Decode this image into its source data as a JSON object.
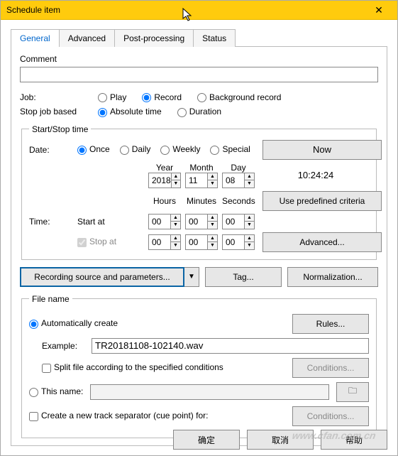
{
  "title": "Schedule item",
  "tabs": [
    "General",
    "Advanced",
    "Post-processing",
    "Status"
  ],
  "activeTab": 0,
  "general": {
    "commentLabel": "Comment",
    "commentValue": "",
    "jobLabel": "Job:",
    "jobOptions": [
      "Play",
      "Record",
      "Background record"
    ],
    "jobSelected": "Record",
    "stopLabel": "Stop job based",
    "stopOptions": [
      "Absolute time",
      "Duration"
    ],
    "stopSelected": "Absolute time",
    "startstop": {
      "legend": "Start/Stop time",
      "dateLabel": "Date:",
      "freqOptions": [
        "Once",
        "Daily",
        "Weekly",
        "Special"
      ],
      "freqSelected": "Once",
      "yearLabel": "Year",
      "monthLabel": "Month",
      "dayLabel": "Day",
      "year": "2018",
      "month": "11",
      "day": "08",
      "hoursLabel": "Hours",
      "minutesLabel": "Minutes",
      "secondsLabel": "Seconds",
      "startAtLabel": "Start at",
      "stopAtLabel": "Stop at",
      "timeLabel": "Time:",
      "startH": "00",
      "startM": "00",
      "startS": "00",
      "stopH": "00",
      "stopM": "00",
      "stopS": "00",
      "nowBtn": "Now",
      "clockText": "10:24:24",
      "predefinedBtn": "Use predefined criteria",
      "advancedBtn": "Advanced..."
    },
    "recordingSrcBtn": "Recording source and parameters...",
    "tagBtn": "Tag...",
    "normBtn": "Normalization...",
    "filename": {
      "legend": "File name",
      "autoLabel": "Automatically create",
      "rulesBtn": "Rules...",
      "exampleLabel": "Example:",
      "exampleValue": "TR20181108-102140.wav",
      "splitLabel": "Split file according to the specified conditions",
      "conditionsBtn": "Conditions...",
      "thisNameLabel": "This name:",
      "thisNameValue": "",
      "browseIcon": "folder-icon",
      "cueLabel": "Create a new track separator (cue point) for:",
      "conditionsBtn2": "Conditions..."
    }
  },
  "footer": {
    "ok": "确定",
    "cancel": "取消",
    "help": "帮助"
  },
  "watermark": "www.cfan.com.cn"
}
